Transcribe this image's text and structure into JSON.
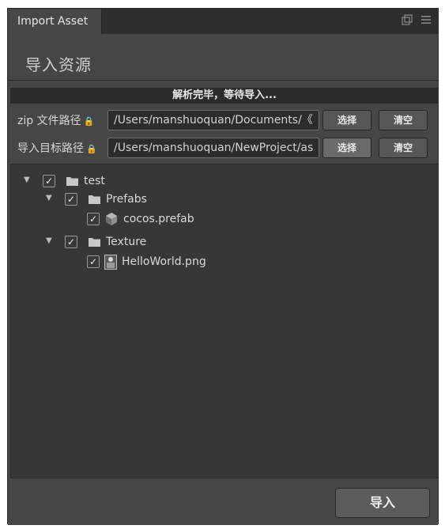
{
  "tab": {
    "title": "Import Asset"
  },
  "icons": {
    "popout": "popout-window-icon",
    "menu": "hamburger-menu-icon",
    "lock": "lock-icon",
    "folder": "folder-icon",
    "prefab": "prefab-cube-icon",
    "image": "image-file-icon"
  },
  "heading": "导入资源",
  "status": "解析完毕，等待导入...",
  "zip_row": {
    "label": "zip 文件路径",
    "path": "/Users/manshuoquan/Documents/《",
    "select": "选择",
    "clear": "清空"
  },
  "target_row": {
    "label": "导入目标路径",
    "path": "/Users/manshuoquan/NewProject/as",
    "select": "选择",
    "clear": "清空"
  },
  "tree": {
    "root": {
      "name": "test",
      "checked": true,
      "expanded": true
    },
    "prefabs": {
      "name": "Prefabs",
      "checked": true,
      "expanded": true
    },
    "cocos_prefab": {
      "name": "cocos.prefab",
      "checked": true
    },
    "texture": {
      "name": "Texture",
      "checked": true,
      "expanded": true
    },
    "helloworld": {
      "name": "HelloWorld.png",
      "checked": true
    }
  },
  "import_button": "导入"
}
